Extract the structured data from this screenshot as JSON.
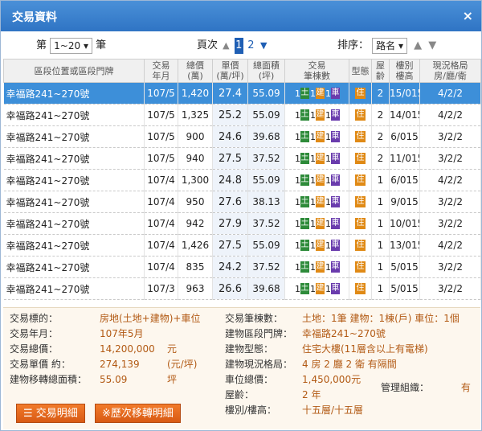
{
  "window": {
    "title": "交易資料",
    "close_icon": "×"
  },
  "controls": {
    "range_prefix": "第",
    "range_value": "1~20",
    "range_suffix": "筆",
    "page_label": "頁次",
    "pages": [
      "1",
      "2"
    ],
    "current_page": "1",
    "sort_label": "排序：",
    "sort_value": "路名"
  },
  "table": {
    "headers": [
      "區段位置或區段門牌",
      "交易\n年月",
      "總價\n(萬)",
      "單價\n(萬/坪)",
      "總面積\n(坪)",
      "交易\n筆棟數",
      "型態",
      "屋\n齡",
      "樓別\n樓高",
      "現況格局\n房/廳/衛"
    ],
    "rows": [
      {
        "addr": "幸福路241~270號",
        "ym": "107/5",
        "total": "1,420",
        "unit": "27.4",
        "area": "55.09",
        "land": "1",
        "bld": "1",
        "car": "1",
        "type": "住",
        "age": "2",
        "floor": "15/015",
        "layout": "4/2/2",
        "selected": true
      },
      {
        "addr": "幸福路241~270號",
        "ym": "107/5",
        "total": "1,325",
        "unit": "25.2",
        "area": "55.09",
        "land": "1",
        "bld": "1",
        "car": "1",
        "type": "住",
        "age": "2",
        "floor": "14/015",
        "layout": "4/2/2"
      },
      {
        "addr": "幸福路241~270號",
        "ym": "107/5",
        "total": "900",
        "unit": "24.6",
        "area": "39.68",
        "land": "1",
        "bld": "1",
        "car": "1",
        "type": "住",
        "age": "2",
        "floor": "6/015",
        "layout": "3/2/2"
      },
      {
        "addr": "幸福路241~270號",
        "ym": "107/5",
        "total": "940",
        "unit": "27.5",
        "area": "37.52",
        "land": "1",
        "bld": "1",
        "car": "1",
        "type": "住",
        "age": "2",
        "floor": "11/015",
        "layout": "3/2/2"
      },
      {
        "addr": "幸福路241~270號",
        "ym": "107/4",
        "total": "1,300",
        "unit": "24.8",
        "area": "55.09",
        "land": "1",
        "bld": "1",
        "car": "1",
        "type": "住",
        "age": "1",
        "floor": "6/015",
        "layout": "4/2/2"
      },
      {
        "addr": "幸福路241~270號",
        "ym": "107/4",
        "total": "950",
        "unit": "27.6",
        "area": "38.13",
        "land": "1",
        "bld": "1",
        "car": "1",
        "type": "住",
        "age": "1",
        "floor": "9/015",
        "layout": "3/2/2"
      },
      {
        "addr": "幸福路241~270號",
        "ym": "107/4",
        "total": "942",
        "unit": "27.9",
        "area": "37.52",
        "land": "1",
        "bld": "1",
        "car": "1",
        "type": "住",
        "age": "1",
        "floor": "10/015",
        "layout": "3/2/2"
      },
      {
        "addr": "幸福路241~270號",
        "ym": "107/4",
        "total": "1,426",
        "unit": "27.5",
        "area": "55.09",
        "land": "1",
        "bld": "1",
        "car": "1",
        "type": "住",
        "age": "1",
        "floor": "13/015",
        "layout": "4/2/2"
      },
      {
        "addr": "幸福路241~270號",
        "ym": "107/4",
        "total": "835",
        "unit": "24.2",
        "area": "37.52",
        "land": "1",
        "bld": "1",
        "car": "1",
        "type": "住",
        "age": "1",
        "floor": "5/015",
        "layout": "3/2/2"
      },
      {
        "addr": "幸福路241~270號",
        "ym": "107/3",
        "total": "963",
        "unit": "26.6",
        "area": "39.68",
        "land": "1",
        "bld": "1",
        "car": "1",
        "type": "住",
        "age": "1",
        "floor": "5/015",
        "layout": "3/2/2"
      }
    ],
    "tag_labels": {
      "land": "土",
      "bld": "建",
      "car": "車"
    }
  },
  "detail": {
    "left": [
      {
        "label": "交易標的：",
        "value": "房地(土地+建物)+車位",
        "unit": ""
      },
      {
        "label": "交易年月：",
        "value": "107年5月",
        "unit": ""
      },
      {
        "label": "交易總價：",
        "value": "14,200,000",
        "unit": "元"
      },
      {
        "label": "交易單價 約：",
        "value": "274,139",
        "unit": "(元/坪)"
      },
      {
        "label": "建物移轉總面積：",
        "value": "55.09",
        "unit": "坪"
      }
    ],
    "right": [
      {
        "label": "交易筆棟數：",
        "value": "土地：1筆 建物：1棟(戶) 車位：1個"
      },
      {
        "label": "建物區段門牌：",
        "value": "幸福路241~270號"
      },
      {
        "label": "建物型態：",
        "value": "住宅大樓(11層含以上有電梯)"
      },
      {
        "label": "建物現況格局：",
        "value": "4 房 2 廳 2 衛 有隔間"
      },
      {
        "label": "車位總價：",
        "value": "1,450,000元"
      },
      {
        "label": "屋齡：",
        "value": "2 年"
      },
      {
        "label": "樓別/樓高：",
        "value": "十五層/十五層"
      }
    ],
    "management_label": "管理組織：",
    "management_value": "有",
    "btn_detail": "交易明細",
    "btn_history": "※歷次移轉明細"
  }
}
